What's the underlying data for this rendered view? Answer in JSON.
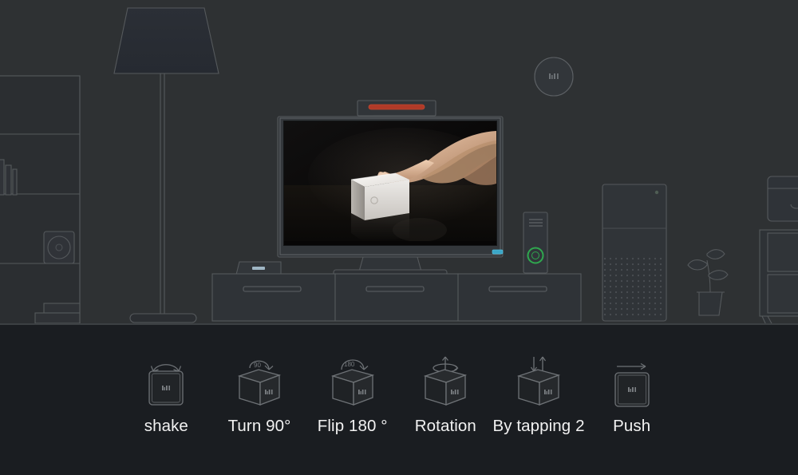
{
  "scene": {
    "background_color": "#2e3133",
    "outline_color": "#55595c",
    "panel_color": "#1a1d21",
    "objects": [
      {
        "name": "bookshelf",
        "desc": "wall shelving unit with books and speaker"
      },
      {
        "name": "floor-lamp",
        "desc": "tall floor lamp with trapezoid shade"
      },
      {
        "name": "tv",
        "desc": "flat screen television on stand"
      },
      {
        "name": "tv-camera-bar",
        "desc": "camera soundbar with red LED on top of tv"
      },
      {
        "name": "tv-cabinet",
        "desc": "three section media cabinet"
      },
      {
        "name": "set-top-box",
        "desc": "small set top box with blue LED"
      },
      {
        "name": "router",
        "desc": "wifi router with green ring indicator"
      },
      {
        "name": "ai-speaker",
        "desc": "tall smart speaker with perforated grille"
      },
      {
        "name": "potted-plant",
        "desc": "small plant in pot"
      },
      {
        "name": "side-cabinet",
        "desc": "cabinet with drawers on the right"
      },
      {
        "name": "wall-disc",
        "desc": "round mi branded ceiling sensor"
      }
    ],
    "brand_mark": "mi",
    "tv_led_color": "#3aa6c8",
    "camera_led_color": "#b03a28",
    "router_led_color": "#2fa84f"
  },
  "tv_photo": {
    "description": "hand pressing a white mi cube on a glossy dark surface",
    "background_color": "#0a0907",
    "cube_color": "#e8e6e3",
    "hand_color": "#d8b79c"
  },
  "gestures": {
    "items": [
      {
        "id": "shake",
        "label": "shake",
        "icon": "cube-shake-icon",
        "arrow": "arc",
        "badge": ""
      },
      {
        "id": "turn90",
        "label": "Turn 90°",
        "icon": "cube-turn-icon",
        "arrow": "curved-90",
        "badge": "90"
      },
      {
        "id": "flip180",
        "label": "Flip 180 °",
        "icon": "cube-flip-icon",
        "arrow": "curved-180",
        "badge": "180"
      },
      {
        "id": "rotation",
        "label": "Rotation",
        "icon": "cube-rotation-icon",
        "arrow": "spin-ellipse",
        "badge": ""
      },
      {
        "id": "tapping2",
        "label": "By tapping 2",
        "icon": "cube-tap-icon",
        "arrow": "up-down",
        "badge": ""
      },
      {
        "id": "push",
        "label": "Push",
        "icon": "cube-push-icon",
        "arrow": "right",
        "badge": ""
      }
    ]
  }
}
